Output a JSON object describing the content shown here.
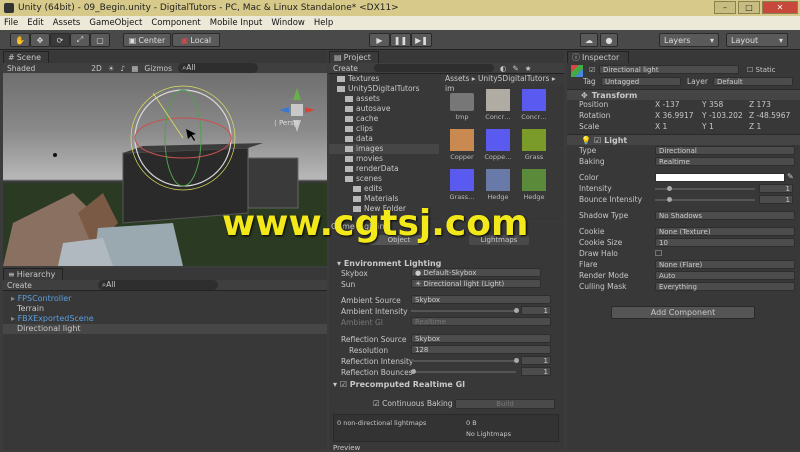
{
  "window": {
    "title": "Unity (64bit) - 09_Begin.unity - DigitalTutors - PC, Mac & Linux Standalone* <DX11>"
  },
  "menu": [
    "File",
    "Edit",
    "Assets",
    "GameObject",
    "Component",
    "Mobile Input",
    "Window",
    "Help"
  ],
  "toolbar": {
    "center": "Center",
    "local": "Local",
    "layers": "Layers",
    "layout": "Layout"
  },
  "scene": {
    "tab": "Scene",
    "shading": "Shaded",
    "mode2d": "2D",
    "gizmos": "Gizmos",
    "search": "All"
  },
  "hierarchy": {
    "tab": "Hierarchy",
    "create": "Create",
    "search": "All",
    "items": [
      {
        "label": "FPSController",
        "color": "#5a9fe0"
      },
      {
        "label": "Terrain",
        "color": "#c8c8c8"
      },
      {
        "label": "FBXExportedScene",
        "color": "#5a9fe0"
      },
      {
        "label": "Directional light",
        "color": "#c8c8c8"
      }
    ]
  },
  "project": {
    "tab": "Project",
    "create": "Create",
    "breadcrumb": "Assets ▸ Unity5DigitalTutors ▸ im",
    "tree": [
      "Textures",
      "Unity5DigitalTutors",
      "assets",
      "autosave",
      "cache",
      "clips",
      "data",
      "images",
      "movies",
      "renderData",
      "scenes",
      "edits",
      "Materials",
      "New Folder"
    ],
    "assets": [
      {
        "label": "tmp",
        "color": "#777777"
      },
      {
        "label": "Concr…",
        "color": "#b0aca4"
      },
      {
        "label": "Concr…",
        "color": "#5a5af0"
      },
      {
        "label": "Copper",
        "color": "#c88a50"
      },
      {
        "label": "Coppe…",
        "color": "#5a5af0"
      },
      {
        "label": "Grass",
        "color": "#7a9a2a"
      },
      {
        "label": "Grass…",
        "color": "#5a5af0"
      },
      {
        "label": "Hedge",
        "color": "#6a7aa8"
      },
      {
        "label": "Hedge",
        "color": "#5a8a3a"
      }
    ]
  },
  "lighting": {
    "tabs": "Game  Lighting",
    "object": "Object",
    "lightmaps": "Lightmaps",
    "env_title": "Environment Lighting",
    "skybox_label": "Skybox",
    "skybox_value": "Default-Skybox",
    "sun_label": "Sun",
    "sun_value": "Directional light (Light)",
    "amb_source_label": "Ambient Source",
    "amb_source_value": "Skybox",
    "amb_intensity_label": "Ambient Intensity",
    "amb_intensity_value": "1",
    "amb_gi_label": "Ambient GI",
    "amb_gi_value": "Realtime",
    "refl_source_label": "Reflection Source",
    "refl_source_value": "Skybox",
    "resolution_label": "Resolution",
    "resolution_value": "128",
    "refl_intensity_label": "Reflection Intensity",
    "refl_intensity_value": "1",
    "refl_bounces_label": "Reflection Bounces",
    "refl_bounces_value": "1",
    "precomputed_title": "Precomputed Realtime GI",
    "continuous": "Continuous Baking",
    "build": "Build",
    "nondirectional": "0 non-directional lightmaps",
    "size": "0 B",
    "no_lightmaps": "No Lightmaps",
    "preview": "Preview"
  },
  "inspector": {
    "tab": "Inspector",
    "name": "Directional light",
    "static": "Static",
    "tag_label": "Tag",
    "tag_value": "Untagged",
    "layer_label": "Layer",
    "layer_value": "Default",
    "transform_title": "Transform",
    "position_label": "Position",
    "pos_x": "-137",
    "pos_y": "358",
    "pos_z": "173",
    "rotation_label": "Rotation",
    "rot_x": "36.9917",
    "rot_y": "-103.202",
    "rot_z": "-48.5967",
    "scale_label": "Scale",
    "scale_x": "1",
    "scale_y": "1",
    "scale_z": "1",
    "light_title": "Light",
    "type_label": "Type",
    "type_value": "Directional",
    "baking_label": "Baking",
    "baking_value": "Realtime",
    "color_label": "Color",
    "intensity_label": "Intensity",
    "intensity_value": "1",
    "bounce_label": "Bounce Intensity",
    "bounce_value": "1",
    "shadow_label": "Shadow Type",
    "shadow_value": "No Shadows",
    "cookie_label": "Cookie",
    "cookie_value": "None (Texture)",
    "cookie_size_label": "Cookie Size",
    "cookie_size_value": "10",
    "halo_label": "Draw Halo",
    "flare_label": "Flare",
    "flare_value": "None (Flare)",
    "render_mode_label": "Render Mode",
    "render_mode_value": "Auto",
    "culling_label": "Culling Mask",
    "culling_value": "Everything",
    "add_component": "Add Component"
  },
  "watermark": "www.cgtsj.com",
  "colors": {
    "titlebar": "#d6c98a",
    "panel": "#383838",
    "accent": "#5a9fe0",
    "watermark": "#f2e81a"
  }
}
